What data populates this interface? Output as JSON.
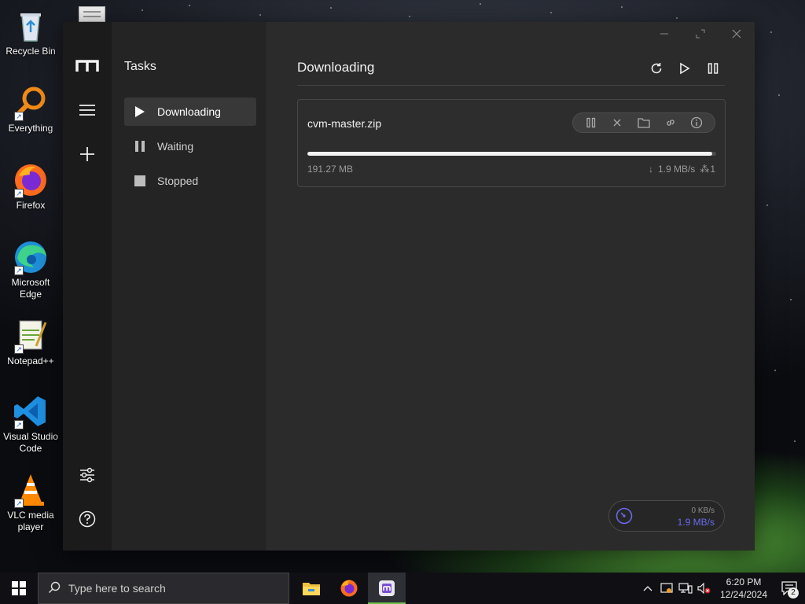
{
  "desktop": {
    "icons": [
      {
        "label": "Recycle Bin"
      },
      {
        "label": "Everything"
      },
      {
        "label": "Firefox"
      },
      {
        "label": "Microsoft Edge"
      },
      {
        "label": "Notepad++"
      },
      {
        "label": "Visual Studio Code"
      },
      {
        "label": "VLC media player"
      }
    ]
  },
  "app": {
    "sidebar": {
      "title": "Tasks",
      "items": [
        {
          "label": "Downloading",
          "active": true
        },
        {
          "label": "Waiting"
        },
        {
          "label": "Stopped"
        }
      ]
    },
    "main": {
      "title": "Downloading",
      "task": {
        "name": "cvm-master.zip",
        "progress": 0.99,
        "size": "191.27 MB",
        "speed": "1.9 MB/s",
        "connections": "1"
      }
    },
    "speed_widget": {
      "upload": "0 KB/s",
      "download": "1.9 MB/s"
    },
    "colors": {
      "accent": "#6a6af0"
    }
  },
  "taskbar": {
    "search_placeholder": "Type here to search",
    "time": "6:20 PM",
    "date": "12/24/2024",
    "notification_count": "2"
  }
}
